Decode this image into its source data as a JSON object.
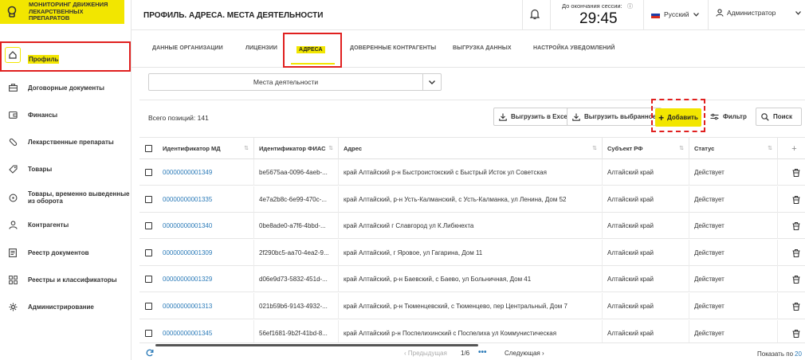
{
  "logo": {
    "line1": "МОНИТОРИНГ ДВИЖЕНИЯ",
    "line2": "ЛЕКАРСТВЕННЫХ ПРЕПАРАТОВ"
  },
  "sidebar": {
    "items": [
      {
        "label": "Профиль",
        "icon": "home-icon"
      },
      {
        "label": "Договорные документы",
        "icon": "briefcase-icon"
      },
      {
        "label": "Финансы",
        "icon": "wallet-icon"
      },
      {
        "label": "Лекарственные препараты",
        "icon": "pill-icon"
      },
      {
        "label": "Товары",
        "icon": "tag-icon"
      },
      {
        "label": "Товары, временно выведенные",
        "label2": "из оборота",
        "icon": "return-icon"
      },
      {
        "label": "Контрагенты",
        "icon": "person-icon"
      },
      {
        "label": "Реестр документов",
        "icon": "document-icon"
      },
      {
        "label": "Реестры и классификаторы",
        "icon": "grid-icon"
      },
      {
        "label": "Администрирование",
        "icon": "gear-icon"
      }
    ]
  },
  "header": {
    "title": "ПРОФИЛЬ. АДРЕСА. МЕСТА ДЕЯТЕЛЬНОСТИ",
    "session_label": "До окончания сессии:",
    "session_info": "ⓘ",
    "session_time": "29:45",
    "language": "Русский",
    "user": "Администратор"
  },
  "tabs": [
    "ДАННЫЕ ОРГАНИЗАЦИИ",
    "ЛИЦЕНЗИИ",
    "АДРЕСА",
    "ДОВЕРЕННЫЕ КОНТРАГЕНТЫ",
    "ВЫГРУЗКА ДАННЫХ",
    "НАСТРОЙКА УВЕДОМЛЕНИЙ"
  ],
  "active_tab": "АДРЕСА",
  "select": {
    "value": "Места деятельности"
  },
  "toolbar": {
    "total": "Всего позиций: 141",
    "export_excel": "Выгрузить в Excel",
    "export_selected": "Выгрузить выбранное",
    "add": "Добавить",
    "filter": "Фильтр",
    "search": "Поиск"
  },
  "table": {
    "columns": [
      "Идентификатор МД",
      "Идентификатор ФИАС",
      "Адрес",
      "Субъект РФ",
      "Статус"
    ],
    "rows": [
      [
        "00000000001349",
        "be5675aa-0096-4aeb-...",
        "край Алтайский р-н Быстроистокский с Быстрый Исток ул Советская",
        "Алтайский край",
        "Действует"
      ],
      [
        "00000000001335",
        "4e7a2b8c-6e99-470c-...",
        "край Алтайский, р-н Усть-Калманский, с Усть-Калманка, ул Ленина, Дом 52",
        "Алтайский край",
        "Действует"
      ],
      [
        "00000000001340",
        "0be8ade0-a7f6-4bbd-...",
        "край Алтайский г Славгород ул К.Либкнехта",
        "Алтайский край",
        "Действует"
      ],
      [
        "00000000001309",
        "2f290bc5-aa70-4ea2-9...",
        "край Алтайский, г Яровое, ул Гагарина, Дом 11",
        "Алтайский край",
        "Действует"
      ],
      [
        "00000000001329",
        "d06e9d73-5832-451d-...",
        "край Алтайский, р-н Баевский, с Баево, ул Больничная, Дом 41",
        "Алтайский край",
        "Действует"
      ],
      [
        "00000000001313",
        "021b59b6-9143-4932-...",
        "край Алтайский, р-н Тюменцевский, с Тюменцево, пер Центральный, Дом 7",
        "Алтайский край",
        "Действует"
      ],
      [
        "00000000001345",
        "56ef1681-9b2f-41bd-8...",
        "край Алтайский р-н Поспелихинский с Поспелиха ул Коммунистическая",
        "Алтайский край",
        "Действует"
      ]
    ]
  },
  "pagination": {
    "prev": "‹  Предыдущая",
    "page": "1/6",
    "dots": "•••",
    "next": "Следующая  ›",
    "show_label": "Показать по",
    "show_value": "20"
  },
  "colors": {
    "accent": "#f2e600",
    "highlight_border": "#e0201f",
    "link": "#2a7ab8"
  }
}
